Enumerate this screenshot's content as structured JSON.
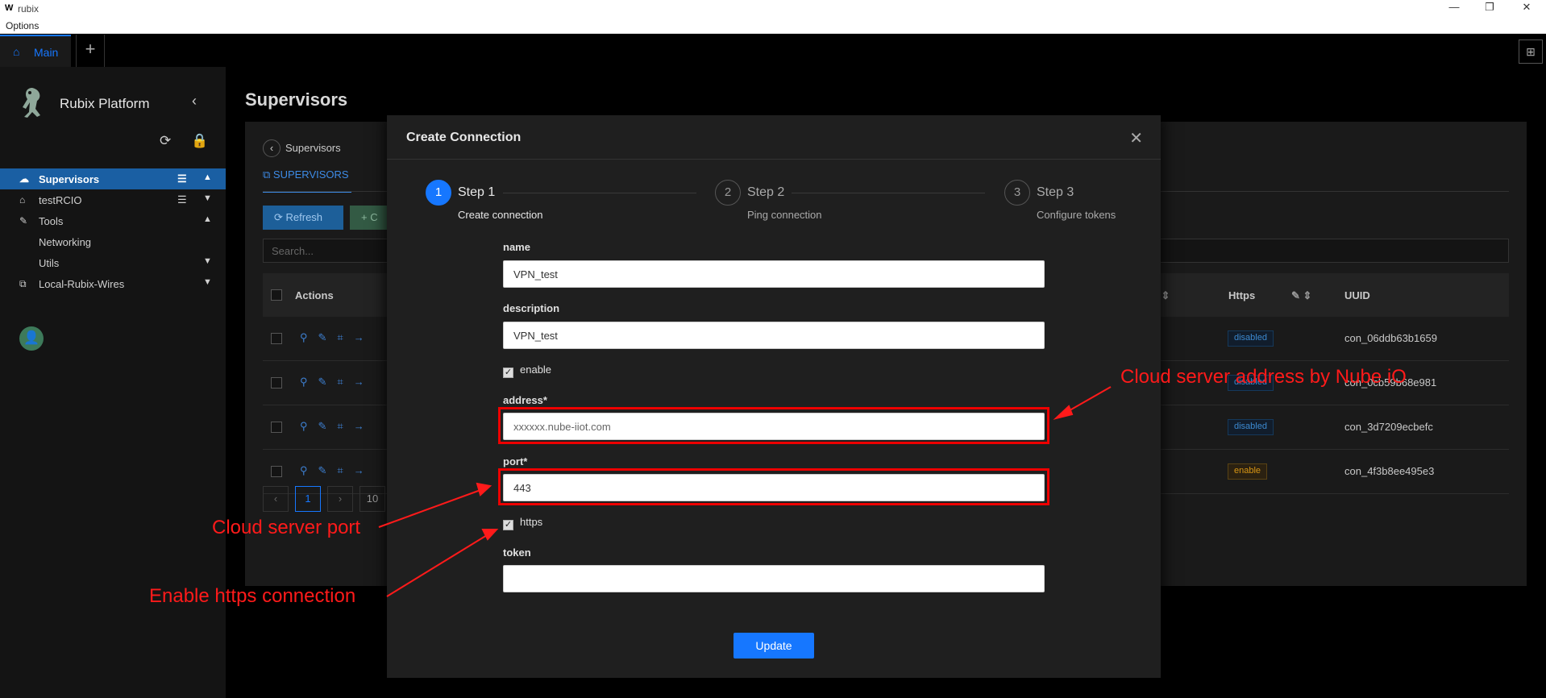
{
  "window": {
    "app_icon": "W",
    "title": "rubix",
    "minimize": "—",
    "restore": "❐",
    "close": "✕"
  },
  "menu": {
    "options": "Options"
  },
  "tabs": {
    "main": "Main",
    "add": "+",
    "layout_icon": "⊞"
  },
  "sidebar": {
    "brand": "Rubix Platform",
    "items": [
      {
        "label": "Supervisors",
        "icon": "cloud-icon",
        "active": true
      },
      {
        "label": "testRCIO",
        "icon": "home-icon"
      },
      {
        "label": "Tools",
        "icon": "wrench-icon"
      },
      {
        "label": "Networking"
      },
      {
        "label": "Utils"
      },
      {
        "label": "Local-Rubix-Wires",
        "icon": "network-icon"
      }
    ]
  },
  "main": {
    "title": "Supervisors",
    "back_label": "Supervisors",
    "tab_label": "SUPERVISORS",
    "refresh_label": "Refresh",
    "create_label": "C",
    "search_placeholder": "Search...",
    "columns": {
      "actions": "Actions",
      "https": "Https",
      "uuid": "UUID"
    },
    "rows": [
      {
        "https": "disabled",
        "uuid": "con_06ddb63b1659"
      },
      {
        "https": "disabled",
        "uuid": "con_0cb59b68e981"
      },
      {
        "https": "disabled",
        "uuid": "con_3d7209ecbefc"
      },
      {
        "https": "enable",
        "uuid": "con_4f3b8ee495e3"
      }
    ],
    "pager": {
      "current": "1",
      "size": "10"
    }
  },
  "modal": {
    "title": "Create Connection",
    "steps": [
      {
        "num": "1",
        "title": "Step 1",
        "desc": "Create connection"
      },
      {
        "num": "2",
        "title": "Step 2",
        "desc": "Ping connection"
      },
      {
        "num": "3",
        "title": "Step 3",
        "desc": "Configure tokens"
      }
    ],
    "fields": {
      "name_label": "name",
      "name_value": "VPN_test",
      "description_label": "description",
      "description_value": "VPN_test",
      "enable_label": "enable",
      "address_label": "address*",
      "address_placeholder": "xxxxxx.nube-iiot.com",
      "port_label": "port*",
      "port_value": "443",
      "https_label": "https",
      "token_label": "token",
      "token_value": ""
    },
    "update_label": "Update"
  },
  "annotations": {
    "address": "Cloud server address by Nube iO",
    "port": "Cloud server port",
    "https": "Enable https connection"
  }
}
